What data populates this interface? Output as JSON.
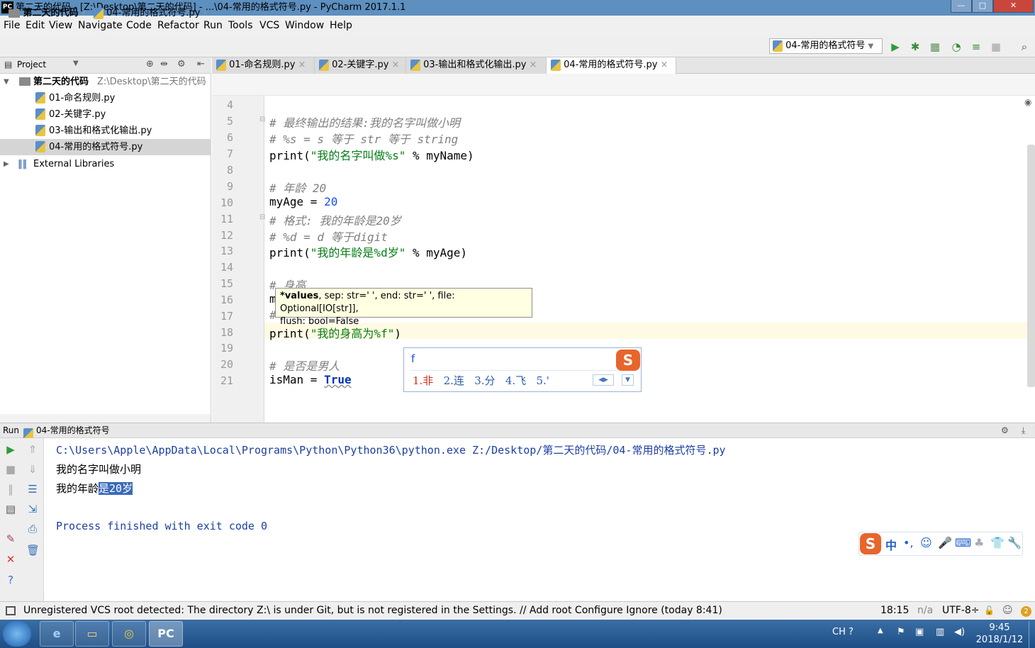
{
  "window": {
    "title": "第二天的代码 - [Z:\\Desktop\\第二天的代码] - ...\\04-常用的格式符号.py - PyCharm 2017.1.1",
    "app_icon": "PC"
  },
  "menu": [
    "File",
    "Edit",
    "View",
    "Navigate",
    "Code",
    "Refactor",
    "Run",
    "Tools",
    "VCS",
    "Window",
    "Help"
  ],
  "breadcrumb": {
    "project": "第二天的代码",
    "file": "04-常用的格式符号.py"
  },
  "run_config": "04-常用的格式符号",
  "project_panel": {
    "title": "Project",
    "root_name": "第二天的代码",
    "root_path": "Z:\\Desktop\\第二天的代码",
    "files": [
      "01-命名规则.py",
      "02-关键字.py",
      "03-输出和格式化输出.py",
      "04-常用的格式符号.py"
    ],
    "external": "External Libraries"
  },
  "tabs": [
    "01-命名规则.py",
    "02-关键字.py",
    "03-输出和格式化输出.py",
    "04-常用的格式符号.py"
  ],
  "editor": {
    "lines": {
      "l4": "",
      "l5": "# 最终输出的结果:我的名字叫做小明",
      "l6": "# %s = s 等于 str 等于 string",
      "l7_a": "print(",
      "l7_s": "\"我的名字叫做%s\"",
      "l7_b": " % myName)",
      "l9": "# 年龄 20",
      "l10_a": "myAge = ",
      "l10_n": "20",
      "l11": "# 格式: 我的年龄是20岁",
      "l12": "# %d = d 等于digit",
      "l13_a": "print(",
      "l13_s": "\"我的年龄是%d岁\"",
      "l13_b": " % myAge)",
      "l15": "# 身高",
      "l16": "m",
      "l17": "#",
      "l18_a": "print(",
      "l18_s": "\"我的身高为%f\"",
      "l18_b": ")",
      "l20": "# 是否是男人",
      "l21_a": "isMan = ",
      "l21_k": "True"
    },
    "line_numbers": [
      "4",
      "5",
      "6",
      "7",
      "8",
      "9",
      "10",
      "11",
      "12",
      "13",
      "14",
      "15",
      "16",
      "17",
      "18",
      "19",
      "20",
      "21"
    ]
  },
  "tooltip": {
    "bold": "*values",
    "rest": ", sep: str=' ', end: str=' ', file: Optional[IO[str]],",
    "line2": "flush: bool=False"
  },
  "ime": {
    "input": "f",
    "candidates": [
      "1.非",
      "2.连",
      "3.分",
      "4.飞",
      "5.'"
    ]
  },
  "run_panel": {
    "label": "Run",
    "config": "04-常用的格式符号",
    "cmd": "C:\\Users\\Apple\\AppData\\Local\\Programs\\Python\\Python36\\python.exe Z:/Desktop/第二天的代码/04-常用的格式符号.py",
    "out1": "我的名字叫做小明",
    "out2_a": "我的年龄",
    "out2_b": "是20岁",
    "finished": "Process finished with exit code 0"
  },
  "ime_toolbar": [
    "中",
    "•,",
    "☺",
    "🎤",
    "⌨",
    "♣",
    "👕",
    "🔧"
  ],
  "status": {
    "message": "Unregistered VCS root detected: The directory Z:\\ is under Git, but is not registered in the Settings. // Add root  Configure  Ignore (today 8:41)",
    "position": "18:15",
    "na": "n/a",
    "encoding": "UTF-8÷",
    "badge": "2"
  },
  "taskbar": {
    "lang": "CH",
    "time": "9:45",
    "date": "2018/1/12"
  },
  "colors": {
    "string": "#067d17",
    "number": "#1750eb",
    "keyword": "#0033b3",
    "comment": "#808080",
    "current_line": "#fffae3"
  }
}
